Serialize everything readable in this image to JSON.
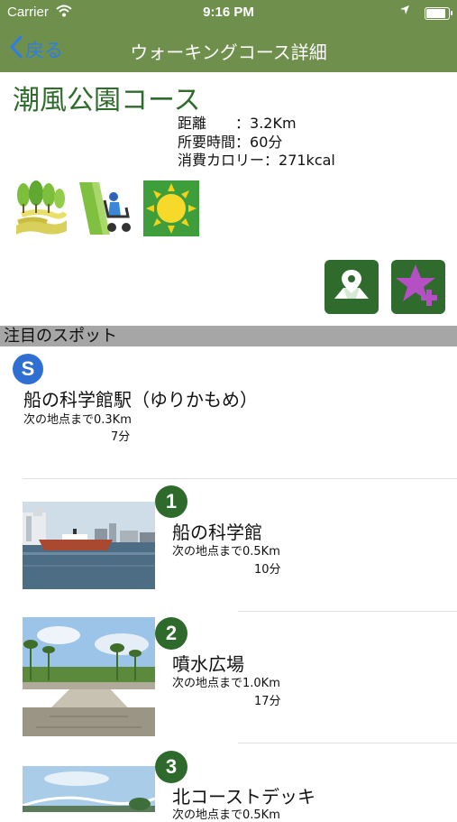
{
  "status_bar": {
    "carrier": "Carrier",
    "time": "9:16 PM"
  },
  "nav": {
    "back_label": "戻る",
    "title": "ウォーキングコース詳細"
  },
  "course": {
    "name": "潮風公園コース",
    "distance_label": "距離　　：",
    "distance_value": "3.2Km",
    "time_label": "所要時間：",
    "time_value": "60分",
    "calorie_label": "消費カロリー：",
    "calorie_value": "271kcal"
  },
  "features": [
    {
      "icon": "park-trees-icon"
    },
    {
      "icon": "stroller-icon"
    },
    {
      "icon": "sun-icon"
    }
  ],
  "actions": {
    "map_icon": "map-pin-icon",
    "favorite_icon": "star-add-icon"
  },
  "section": {
    "header": "注目のスポット"
  },
  "start_spot": {
    "badge": "S",
    "name": "船の科学館駅（ゆりかもめ）",
    "next_dist": "次の地点まで0.3Km",
    "next_time": "7分"
  },
  "spots": [
    {
      "number": "1",
      "name": "船の科学館",
      "next_dist": "次の地点まで0.5Km",
      "next_time": "10分"
    },
    {
      "number": "2",
      "name": "噴水広場",
      "next_dist": "次の地点まで1.0Km",
      "next_time": "17分"
    },
    {
      "number": "3",
      "name": "北コーストデッキ",
      "next_dist": "次の地点まで0.5Km"
    }
  ],
  "colors": {
    "bar": "#6f8f4c",
    "title_green": "#2f6b2c",
    "badge_green": "#2e6a2c",
    "start_blue": "#2f6fd1",
    "ios_blue": "#2d7ee8",
    "favorite_purple": "#b44fc4"
  }
}
